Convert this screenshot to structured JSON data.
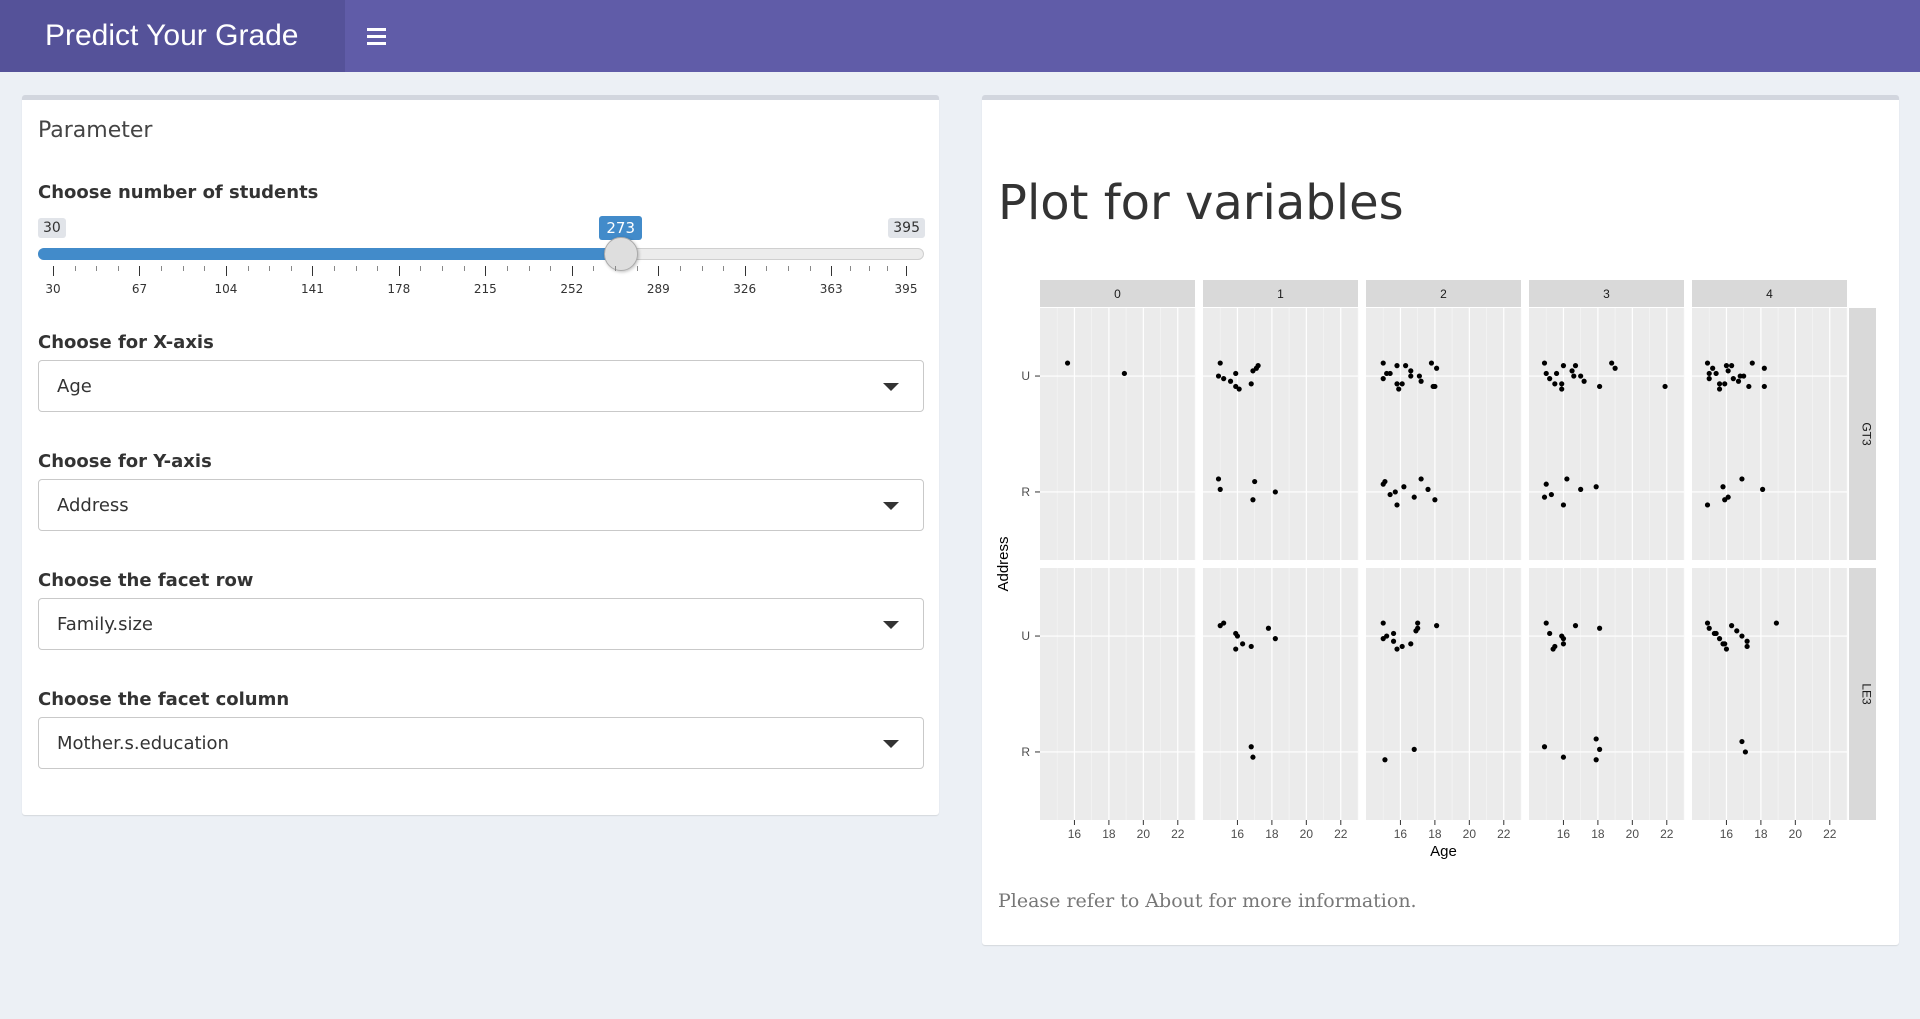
{
  "header": {
    "title": "Predict Your Grade",
    "menu_icon": "hamburger-icon",
    "color": "#605ca8",
    "logo_color": "#555299"
  },
  "sidebar_panel": {
    "title": "Parameter",
    "slider": {
      "label": "Choose number of students",
      "min": 30,
      "max": 395,
      "value": 273,
      "min_label": "30",
      "max_label": "395",
      "value_label": "273",
      "grid_labels": [
        "30",
        "67",
        "104",
        "141",
        "178",
        "215",
        "252",
        "289",
        "326",
        "363",
        "395"
      ],
      "color": "#428bca"
    },
    "x_axis": {
      "label": "Choose for X-axis",
      "value": "Age"
    },
    "y_axis": {
      "label": "Choose for Y-axis",
      "value": "Address"
    },
    "facet_row": {
      "label": "Choose the facet row",
      "value": "Family.size"
    },
    "facet_col": {
      "label": "Choose the facet column",
      "value": "Mother.s.education"
    }
  },
  "main_panel": {
    "title": "Plot for variables",
    "note": "Please refer to About for more information."
  },
  "chart_data": {
    "type": "scatter",
    "title": "",
    "xlabel": "Age",
    "ylabel": "Address",
    "x_ticks": [
      "16",
      "18",
      "20",
      "22"
    ],
    "xlim": [
      14,
      23
    ],
    "y_categories": [
      "U",
      "R"
    ],
    "facet_cols": [
      "0",
      "1",
      "2",
      "3",
      "4"
    ],
    "facet_rows": [
      "GT3",
      "LE3"
    ],
    "grid": true,
    "panels": [
      {
        "row": "GT3",
        "col": "0",
        "points": [
          [
            15.6,
            "U"
          ],
          [
            18.9,
            "U"
          ]
        ]
      },
      {
        "row": "GT3",
        "col": "1",
        "points": [
          [
            15.0,
            "U"
          ],
          [
            15.9,
            "U"
          ],
          [
            16.8,
            "U"
          ],
          [
            17.2,
            "U"
          ],
          [
            14.9,
            "U"
          ],
          [
            15.9,
            "U"
          ],
          [
            17.1,
            "U"
          ],
          [
            15.2,
            "U"
          ],
          [
            16.1,
            "U"
          ],
          [
            16.9,
            "U"
          ],
          [
            15.6,
            "U"
          ],
          [
            14.9,
            "R"
          ],
          [
            15.0,
            "R"
          ],
          [
            16.9,
            "R"
          ],
          [
            17.0,
            "R"
          ],
          [
            18.2,
            "R"
          ]
        ]
      },
      {
        "row": "GT3",
        "col": "2",
        "points": [
          [
            15.0,
            "U"
          ],
          [
            15.4,
            "U"
          ],
          [
            16.1,
            "U"
          ],
          [
            15.8,
            "U"
          ],
          [
            16.6,
            "U"
          ],
          [
            17.9,
            "U"
          ],
          [
            18.1,
            "U"
          ],
          [
            15.0,
            "U"
          ],
          [
            15.9,
            "U"
          ],
          [
            16.6,
            "U"
          ],
          [
            17.2,
            "U"
          ],
          [
            17.8,
            "U"
          ],
          [
            15.2,
            "U"
          ],
          [
            15.8,
            "U"
          ],
          [
            16.3,
            "U"
          ],
          [
            17.1,
            "U"
          ],
          [
            18.0,
            "U"
          ],
          [
            15.0,
            "R"
          ],
          [
            15.4,
            "R"
          ],
          [
            15.8,
            "R"
          ],
          [
            16.2,
            "R"
          ],
          [
            16.8,
            "R"
          ],
          [
            17.2,
            "R"
          ],
          [
            17.6,
            "R"
          ],
          [
            18.0,
            "R"
          ],
          [
            15.1,
            "R"
          ],
          [
            15.7,
            "R"
          ]
        ]
      },
      {
        "row": "GT3",
        "col": "3",
        "points": [
          [
            14.9,
            "U"
          ],
          [
            15.6,
            "U"
          ],
          [
            15.9,
            "U"
          ],
          [
            16.7,
            "U"
          ],
          [
            17.0,
            "U"
          ],
          [
            18.1,
            "U"
          ],
          [
            19.0,
            "U"
          ],
          [
            15.2,
            "U"
          ],
          [
            15.9,
            "U"
          ],
          [
            16.5,
            "U"
          ],
          [
            17.2,
            "U"
          ],
          [
            18.8,
            "U"
          ],
          [
            15.0,
            "U"
          ],
          [
            15.5,
            "U"
          ],
          [
            16.0,
            "U"
          ],
          [
            16.6,
            "U"
          ],
          [
            21.9,
            "U"
          ],
          [
            15.0,
            "R"
          ],
          [
            15.3,
            "R"
          ],
          [
            16.0,
            "R"
          ],
          [
            17.9,
            "R"
          ],
          [
            14.9,
            "R"
          ],
          [
            16.2,
            "R"
          ],
          [
            17.0,
            "R"
          ]
        ]
      },
      {
        "row": "GT3",
        "col": "4",
        "points": [
          [
            14.9,
            "U"
          ],
          [
            15.4,
            "U"
          ],
          [
            15.9,
            "U"
          ],
          [
            16.3,
            "U"
          ],
          [
            16.8,
            "U"
          ],
          [
            17.3,
            "U"
          ],
          [
            18.2,
            "U"
          ],
          [
            15.0,
            "U"
          ],
          [
            15.6,
            "U"
          ],
          [
            16.1,
            "U"
          ],
          [
            16.7,
            "U"
          ],
          [
            17.5,
            "U"
          ],
          [
            15.0,
            "U"
          ],
          [
            15.6,
            "U"
          ],
          [
            16.0,
            "U"
          ],
          [
            17.0,
            "U"
          ],
          [
            18.2,
            "U"
          ],
          [
            15.2,
            "U"
          ],
          [
            16.4,
            "U"
          ],
          [
            14.9,
            "R"
          ],
          [
            15.8,
            "R"
          ],
          [
            16.1,
            "R"
          ],
          [
            16.9,
            "R"
          ],
          [
            18.1,
            "R"
          ],
          [
            15.9,
            "R"
          ]
        ]
      },
      {
        "row": "LE3",
        "col": "1",
        "points": [
          [
            15.2,
            "U"
          ],
          [
            15.9,
            "U"
          ],
          [
            16.3,
            "U"
          ],
          [
            15.0,
            "U"
          ],
          [
            16.0,
            "U"
          ],
          [
            16.8,
            "U"
          ],
          [
            17.8,
            "U"
          ],
          [
            18.2,
            "U"
          ],
          [
            15.9,
            "U"
          ],
          [
            16.8,
            "R"
          ],
          [
            16.9,
            "R"
          ]
        ]
      },
      {
        "row": "LE3",
        "col": "2",
        "points": [
          [
            15.0,
            "U"
          ],
          [
            15.6,
            "U"
          ],
          [
            16.6,
            "U"
          ],
          [
            18.1,
            "U"
          ],
          [
            15.2,
            "U"
          ],
          [
            16.1,
            "U"
          ],
          [
            17.0,
            "U"
          ],
          [
            15.0,
            "U"
          ],
          [
            15.8,
            "U"
          ],
          [
            16.9,
            "U"
          ],
          [
            15.6,
            "U"
          ],
          [
            17.0,
            "U"
          ],
          [
            16.8,
            "R"
          ],
          [
            15.1,
            "R"
          ]
        ]
      },
      {
        "row": "LE3",
        "col": "3",
        "points": [
          [
            15.0,
            "U"
          ],
          [
            15.2,
            "U"
          ],
          [
            16.0,
            "U"
          ],
          [
            16.7,
            "U"
          ],
          [
            15.9,
            "U"
          ],
          [
            15.5,
            "U"
          ],
          [
            18.1,
            "U"
          ],
          [
            16.0,
            "U"
          ],
          [
            15.4,
            "U"
          ],
          [
            14.9,
            "R"
          ],
          [
            16.0,
            "R"
          ],
          [
            17.9,
            "R"
          ],
          [
            18.1,
            "R"
          ],
          [
            17.9,
            "R"
          ]
        ]
      },
      {
        "row": "LE3",
        "col": "4",
        "points": [
          [
            14.9,
            "U"
          ],
          [
            15.3,
            "U"
          ],
          [
            15.8,
            "U"
          ],
          [
            16.3,
            "U"
          ],
          [
            16.9,
            "U"
          ],
          [
            17.2,
            "U"
          ],
          [
            15.0,
            "U"
          ],
          [
            15.6,
            "U"
          ],
          [
            16.0,
            "U"
          ],
          [
            16.6,
            "U"
          ],
          [
            17.2,
            "U"
          ],
          [
            18.9,
            "U"
          ],
          [
            15.4,
            "U"
          ],
          [
            15.9,
            "U"
          ],
          [
            16.9,
            "R"
          ],
          [
            17.1,
            "R"
          ]
        ]
      }
    ]
  }
}
